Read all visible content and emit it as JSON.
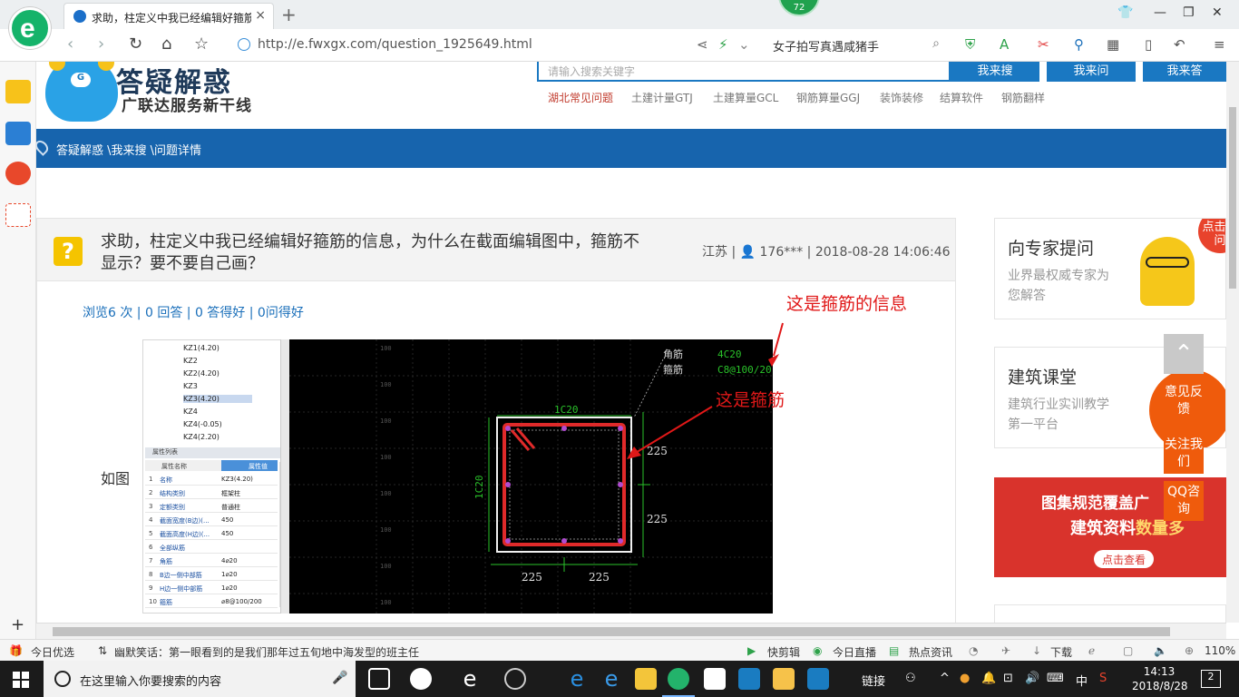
{
  "browser": {
    "tab_title": "求助，柱定义中我已经编辑好箍筋",
    "new_tab": "+",
    "close_tab": "×",
    "badge": "72",
    "url": "http://e.fwxgx.com/question_1925649.html",
    "search_query": "女子拍写真遇咸猪手"
  },
  "site": {
    "title": "答疑解惑",
    "subtitle": "广联达服务新干线",
    "search_placeholder": "请输入搜索关键字",
    "btn_search": "我来搜",
    "btn_ask": "我来问",
    "btn_answer": "我来答",
    "hotlinks": [
      "湖北常见问题",
      "土建计量GTJ",
      "土建算量GCL",
      "钢筋算量GGJ",
      "装饰装修",
      "结算软件",
      "钢筋翻样"
    ],
    "breadcrumb": "答疑解惑 \\我来搜 \\问题详情"
  },
  "question": {
    "title": "求助，柱定义中我已经编辑好箍筋的信息，为什么在截面编辑图中，箍筋不显示？要不要自己画？",
    "meta": "江苏 | 👤 176*** | 2018-08-28 14:06:46",
    "stats": "浏览6 次 | 0 回答 | 0 答得好 | 0问得好",
    "body_label": "如图"
  },
  "screenshot_img": {
    "tree": [
      "KZ1(4.20)",
      "KZ2",
      "KZ2(4.20)",
      "KZ3",
      "KZ3(4.20)",
      "KZ4",
      "KZ4(-0.05)",
      "KZ4(2.20)"
    ],
    "prop_title": "属性列表",
    "prop_head_name": "属性名称",
    "prop_head_val": "属性值",
    "props": [
      {
        "n": "1",
        "k": "名称",
        "v": "KZ3(4.20)"
      },
      {
        "n": "2",
        "k": "结构类别",
        "v": "框架柱"
      },
      {
        "n": "3",
        "k": "定额类别",
        "v": "普通柱"
      },
      {
        "n": "4",
        "k": "截面宽度(B边)(...",
        "v": "450"
      },
      {
        "n": "5",
        "k": "截面高度(H边)(...",
        "v": "450"
      },
      {
        "n": "6",
        "k": "全部纵筋",
        "v": ""
      },
      {
        "n": "7",
        "k": "角筋",
        "v": "4⌀20"
      },
      {
        "n": "8",
        "k": "B边一侧中部筋",
        "v": "1⌀20"
      },
      {
        "n": "9",
        "k": "H边一侧中部筋",
        "v": "1⌀20"
      },
      {
        "n": "10",
        "k": "箍筋",
        "v": "⌀8@100/200"
      }
    ],
    "cad_label_corner": "角筋",
    "cad_label_stirrup": "箍筋",
    "cad_val_corner": "4C20",
    "cad_val_stirrup": "C8@100/20",
    "cad_top": "1C20",
    "cad_left": "1C20",
    "dim_225": "225",
    "tick_100": "100",
    "annot_info": "这是箍筋的信息",
    "annot_stirrup": "这是箍筋"
  },
  "sidebar": {
    "card1_title": "向专家提问",
    "card1_sub": "业界最权威专家为您解答",
    "card1_tag": "点击提问",
    "card2_title": "建筑课堂",
    "card2_sub": "建筑行业实训教学第一平台",
    "banner_l1": "图集规范覆盖广",
    "banner_l2a": "建筑资料",
    "banner_l2b": "数量多",
    "banner_btn": "点击查看",
    "float_feedback": "意见反馈",
    "float_follow": "关注我们",
    "float_qq": "QQ咨询"
  },
  "status": {
    "left_label": "今日优选",
    "news": "幽默笑话：第一眼看到的是我们那年过五旬地中海发型的班主任",
    "kuaijian": "快剪辑",
    "live": "今日直播",
    "hot": "热点资讯",
    "download": "下载",
    "zoom": "110%"
  },
  "taskbar": {
    "search_placeholder": "在这里输入你要搜索的内容",
    "link": "链接",
    "ime": "中",
    "time": "14:13",
    "date": "2018/8/28",
    "notif": "2"
  }
}
